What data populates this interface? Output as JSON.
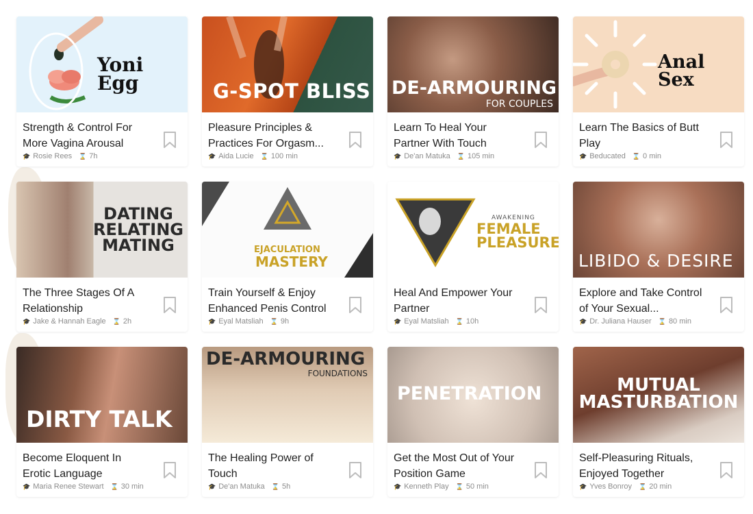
{
  "courses": [
    {
      "thumb_title": "Yoni Egg",
      "title": "Strength & Control For More Vagina Arousal",
      "author": "Rosie Rees",
      "duration": "7h"
    },
    {
      "thumb_title": "G-SPOT BLISS",
      "title": "Pleasure Principles & Practices For Orgasm...",
      "author": "Aida Lucie",
      "duration": "100 min"
    },
    {
      "thumb_title": "DE-ARMOURING",
      "thumb_subtitle": "FOR COUPLES",
      "title": "Learn To Heal Your Partner With Touch",
      "author": "De'an Matuka",
      "duration": "105 min"
    },
    {
      "thumb_title": "Anal Sex",
      "title": "Learn The Basics of Butt Play",
      "author": "Beducated",
      "duration": "0 min"
    },
    {
      "thumb_title": "DATING RELATING MATING",
      "title": "The Three Stages Of A Relationship",
      "author": "Jake & Hannah Eagle",
      "duration": "2h"
    },
    {
      "thumb_title": "MASTERY",
      "thumb_subtitle": "EJACULATION",
      "title": "Train Yourself & Enjoy Enhanced Penis Control",
      "author": "Eyal Matsliah",
      "duration": "9h"
    },
    {
      "thumb_title": "FEMALE PLEASURE",
      "thumb_subtitle": "AWAKENING",
      "title": "Heal And Empower Your Partner",
      "author": "Eyal Matsliah",
      "duration": "10h"
    },
    {
      "thumb_title": "LIBIDO & DESIRE",
      "title": "Explore and Take Control of Your Sexual...",
      "author": "Dr. Juliana Hauser",
      "duration": "80 min"
    },
    {
      "thumb_title": "DIRTY TALK",
      "title": "Become Eloquent In Erotic Language",
      "author": "Maria Renee Stewart",
      "duration": "30 min"
    },
    {
      "thumb_title": "DE-ARMOURING",
      "thumb_subtitle": "FOUNDATIONS",
      "title": "The Healing Power of Touch",
      "author": "De'an Matuka",
      "duration": "5h"
    },
    {
      "thumb_title": "PENETRATION",
      "title": "Get the Most Out of Your Position Game",
      "author": "Kenneth Play",
      "duration": "50 min"
    },
    {
      "thumb_title": "MUTUAL MASTURBATION",
      "title": "Self-Pleasuring Rituals, Enjoyed Together",
      "author": "Yves Bonroy",
      "duration": "20 min"
    }
  ],
  "icons": {
    "author": "graduation-cap-icon",
    "duration": "hourglass-icon",
    "bookmark": "bookmark-icon"
  },
  "colors": {
    "gold": "#c9a227",
    "green": "#2d5240",
    "peach": "#f7dcc2",
    "light_blue": "#e3f2fb"
  }
}
